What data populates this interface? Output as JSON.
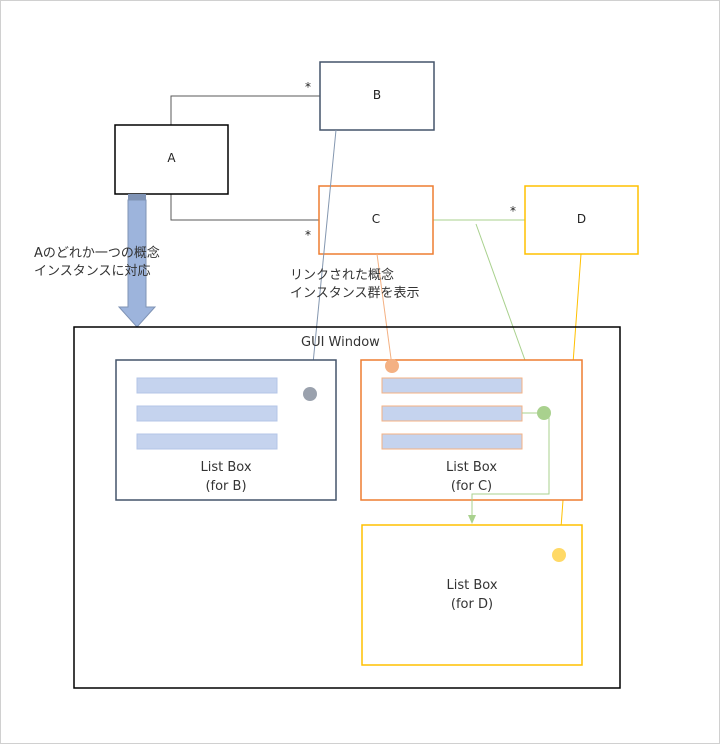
{
  "classes": {
    "a": "A",
    "b": "B",
    "c": "C",
    "d": "D"
  },
  "multiplicities": {
    "ab": "*",
    "ac": "*",
    "cd": "*"
  },
  "notes": {
    "left_line1": "Aのどれか一つの概念",
    "left_line2": "インスタンスに対応",
    "mid_line1": "リンクされた概念",
    "mid_line2": "インスタンス群を表示"
  },
  "gui_window": {
    "title": "GUI Window",
    "listbox_b": {
      "line1": "List Box",
      "line2": "(for B)"
    },
    "listbox_c": {
      "line1": "List Box",
      "line2": "(for C)"
    },
    "listbox_d": {
      "line1": "List Box",
      "line2": "(for D)"
    }
  },
  "colors": {
    "b": "#44546a",
    "c": "#ed7d31",
    "d": "#ffc000",
    "green": "#a9d18e",
    "item_fill": "#c5d3ee",
    "arrow_fill": "#9db4dc"
  }
}
